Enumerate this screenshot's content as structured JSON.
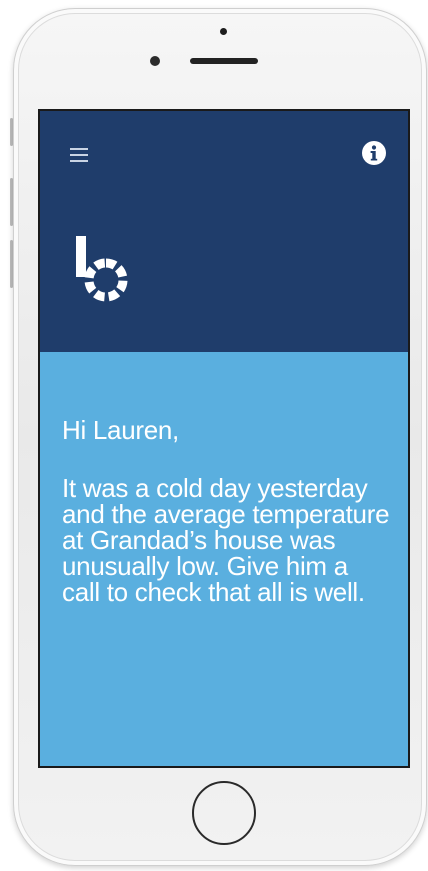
{
  "header": {
    "menu_icon": "hamburger-menu-icon",
    "info_icon": "info-icon",
    "logo": "b-logo"
  },
  "message": {
    "greeting": "Hi Lauren,",
    "body": "It was a cold day yesterday and the average temperature at Grandad’s house was unusually low. Give him a call to check that all is well."
  },
  "colors": {
    "header_bg": "#1f3d6b",
    "content_bg": "#5aafdf",
    "text": "#ffffff"
  }
}
